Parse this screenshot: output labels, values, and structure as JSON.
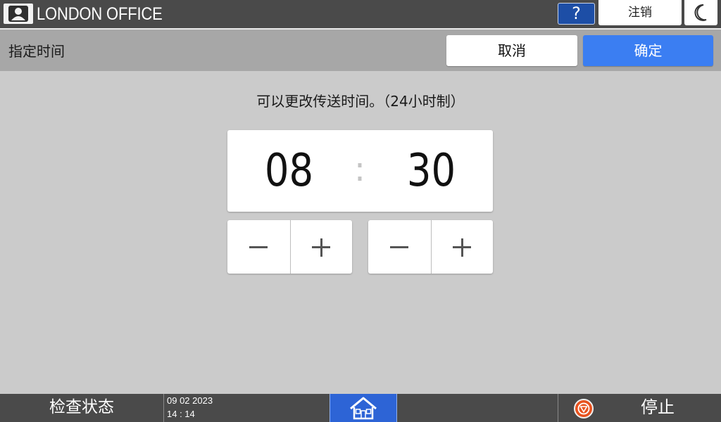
{
  "header": {
    "office_name": "LONDON OFFICE",
    "help_label": "?",
    "logout_label": "注销"
  },
  "titlebar": {
    "title": "指定时间",
    "cancel_label": "取消",
    "ok_label": "确定"
  },
  "main": {
    "instruction": "可以更改传送时间。（24小时制）",
    "hours": "08",
    "separator": ":",
    "minutes": "30"
  },
  "footer": {
    "status_label": "检查状态",
    "date": "09 02 2023",
    "time": "14 : 14",
    "stop_label": "停止"
  },
  "colors": {
    "accent": "#3b7ef2",
    "home_button": "#2d64d6",
    "stop_icon": "#e8531f",
    "bar": "#4a4a4a"
  }
}
